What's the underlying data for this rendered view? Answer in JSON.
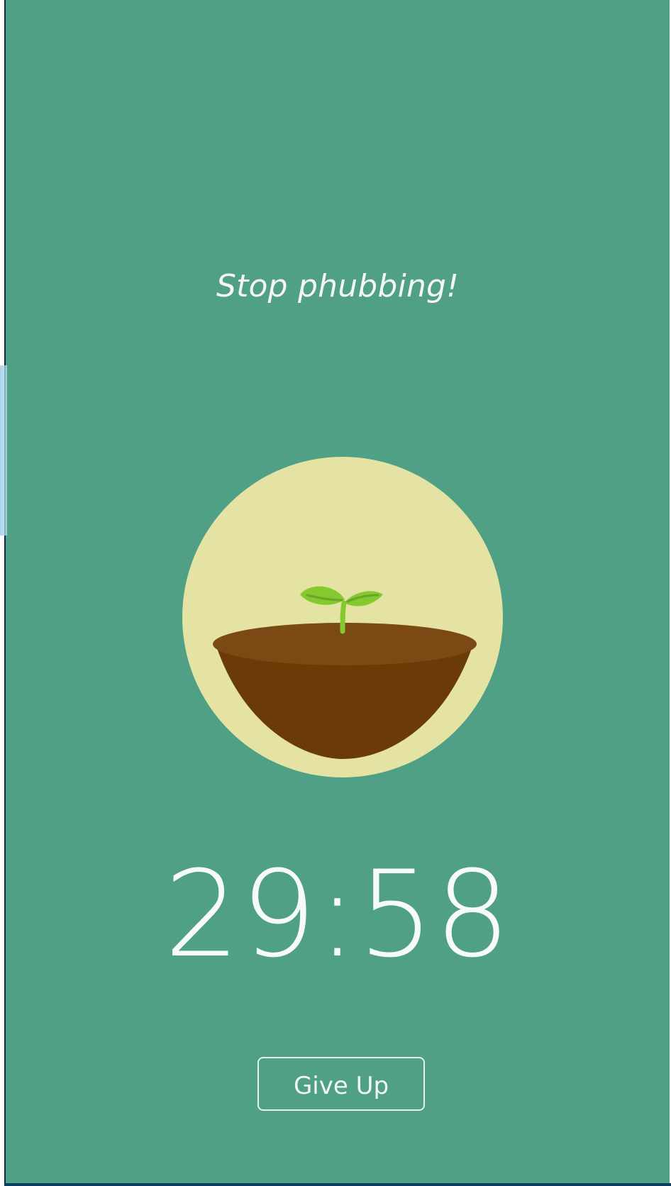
{
  "colors": {
    "background": "#4fa084",
    "circle": "#e4e3a3",
    "soil_top": "#7b4a14",
    "soil_bowl": "#6a3b06",
    "leaf": "#86c92f",
    "stem": "#86c92f",
    "text": "#f4f6f1",
    "border": "#ffffff"
  },
  "screen": {
    "message": "Stop phubbing!",
    "timer": "29:58",
    "give_up_label": "Give Up"
  },
  "icons": {
    "sprout": "sprout-icon"
  }
}
